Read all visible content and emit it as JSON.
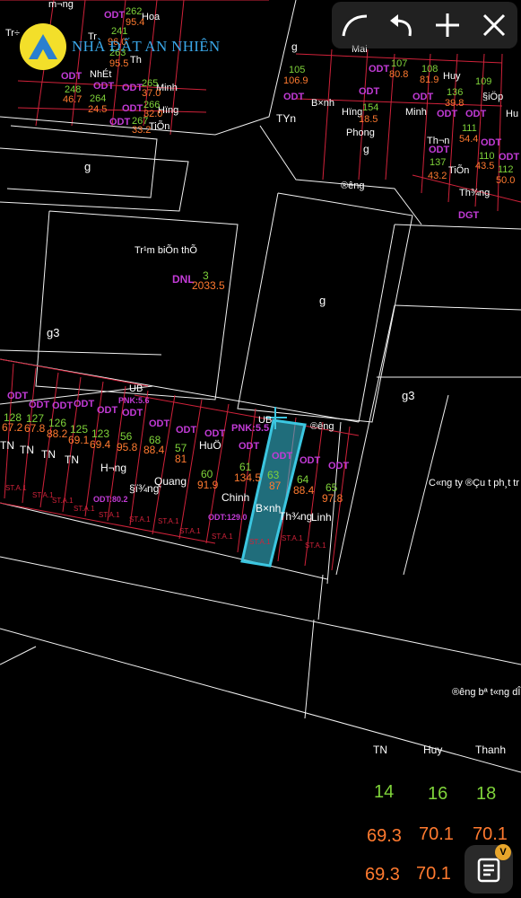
{
  "brand": {
    "name": "NHÀ ĐẤT AN NHIÊN"
  },
  "toolbar": [
    {
      "name": "curve-tool",
      "icon": "curve-icon"
    },
    {
      "name": "undo-tool",
      "icon": "undo-icon"
    },
    {
      "name": "add-tool",
      "icon": "plus-icon"
    },
    {
      "name": "close-tool",
      "icon": "close-icon"
    }
  ],
  "map": {
    "top_labels": [
      "m¬ng",
      "Hoa",
      "Tr÷",
      "Tr­",
      "Th­",
      "NhÉt",
      "Minh",
      "Hïng",
      "TiÕn",
      "Mai",
      "Huy",
      "TYn",
      "B×nh",
      "Hïng",
      "Minh",
      "Phong",
      "Th¬n",
      "TiÕn",
      "Th¾ng",
      "§iÖp",
      "Hu",
      "g",
      "g"
    ],
    "top_numbers": [
      "262",
      "95.4",
      "241",
      "96.0",
      "263",
      "95.5",
      "248",
      "46.7",
      "264",
      "24.5",
      "265",
      "37.0",
      "266",
      "32.0",
      "267",
      "33.2",
      "105",
      "106.9",
      "107",
      "80.8",
      "108",
      "81.9",
      "154",
      "18.5",
      "136",
      "39.8",
      "111",
      "54.4",
      "137",
      "43.2",
      "110",
      "43.5",
      "112",
      "50.0",
      "109"
    ],
    "areas": [
      "g",
      "Tr¹m biÕn thÕ",
      "g",
      "g3",
      "g3",
      "®­êng",
      "DGT",
      "DNL",
      "3",
      "2033.5",
      "UB",
      "UB",
      "®­êng",
      "C«ng ty ®Çu t­ ph¸t tr",
      "®­êng bª t«ng dÎ"
    ],
    "parcels": [
      {
        "owner": "TN",
        "lot": "128",
        "area": "67.2"
      },
      {
        "owner": "TN",
        "lot": "127",
        "area": "67.8"
      },
      {
        "owner": "TN",
        "lot": "126",
        "area": "88.2"
      },
      {
        "owner": "TN",
        "lot": "125",
        "area": "69.1"
      },
      {
        "owner": "H­¬ng",
        "lot": "123",
        "area": "69.4"
      },
      {
        "owner": "§ï¾ng",
        "lot": "56",
        "area": "95.8"
      },
      {
        "owner": "Quang",
        "lot": "68",
        "area": "88.4"
      },
      {
        "owner": "HuÖ",
        "lot": "57",
        "area": "81"
      },
      {
        "owner": "Chinh",
        "lot": "60",
        "area": "91.9"
      },
      {
        "owner": "",
        "lot": "61",
        "area": "134.5"
      },
      {
        "owner": "B×nh",
        "lot": "63",
        "area": "87"
      },
      {
        "owner": "Th¾ng",
        "lot": "64",
        "area": "88.4"
      },
      {
        "owner": "Linh",
        "lot": "65",
        "area": "97.8"
      }
    ],
    "odt": "ODT",
    "pnk": [
      "PNK:5.5",
      "PNK:5.6"
    ],
    "odt_area": [
      "ODT:80.2",
      "ODT:129.0"
    ],
    "stamp": "ST.A.1"
  },
  "panel": {
    "headers": [
      "TN",
      "Huy",
      "Thanh"
    ],
    "rows": [
      [
        "14",
        "16",
        "18"
      ],
      [
        "69.3",
        "70.1",
        "70.1"
      ],
      [
        "69.3",
        "70.1",
        "70.1"
      ]
    ]
  },
  "fab": {
    "icon": "list-icon",
    "badge": "V"
  },
  "colors": {
    "odt": "#c23bd6",
    "green": "#7fd33a",
    "orange": "#ff7a2f",
    "highlight": "#3bc6e0",
    "red_line": "#e0303b"
  }
}
